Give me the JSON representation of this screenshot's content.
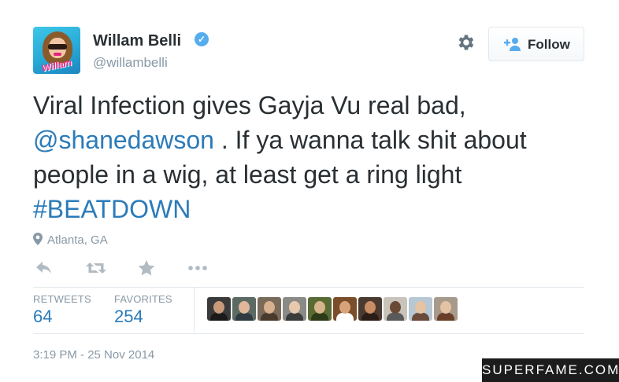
{
  "user": {
    "name": "Willam Belli",
    "handle": "@willambelli",
    "verified_icon": "verified-badge-icon",
    "avatar_logo_text": "Willam"
  },
  "header": {
    "gear_icon": "gear-icon",
    "follow_label": "Follow",
    "follow_icon": "add-person-icon"
  },
  "tweet": {
    "line1": "Viral Infection gives Gayja Vu real bad,",
    "mention": "@shanedawson",
    "line2_rest": " . If ya wanna talk shit about",
    "line3": "people in a wig, at least get a ring light",
    "hashtag": "#BEATDOWN"
  },
  "location": {
    "icon": "location-pin-icon",
    "text": "Atlanta, GA"
  },
  "actions": [
    {
      "icon": "reply-icon"
    },
    {
      "icon": "retweet-icon"
    },
    {
      "icon": "favorite-star-icon"
    },
    {
      "icon": "more-dots-icon"
    }
  ],
  "stats": {
    "retweets_label": "RETWEETS",
    "retweets_value": "64",
    "favorites_label": "FAVORITES",
    "favorites_value": "254"
  },
  "favoriters": [
    {
      "bg": "#3a3a3a",
      "head": "#c79a7a",
      "body": "#1a1a1a"
    },
    {
      "bg": "#5b6b63",
      "head": "#e0b79a",
      "body": "#2e3a40"
    },
    {
      "bg": "#7a6a5a",
      "head": "#d9b08f",
      "body": "#4a3a2e"
    },
    {
      "bg": "#8a8a86",
      "head": "#e8c9ae",
      "body": "#3b3b3b"
    },
    {
      "bg": "#5a6a34",
      "head": "#d7b48c",
      "body": "#2d3a18"
    },
    {
      "bg": "#7a4e2a",
      "head": "#d9a37a",
      "body": "#ffffff"
    },
    {
      "bg": "#4a3a30",
      "head": "#c98c65",
      "body": "#2b1e18"
    },
    {
      "bg": "#c9c4bb",
      "head": "#6b4a35",
      "body": "#5a5a5a"
    },
    {
      "bg": "#b7c7d3",
      "head": "#e6c3a2",
      "body": "#6a4a3a"
    },
    {
      "bg": "#a89a8a",
      "head": "#e4c2a4",
      "body": "#6a3f2a"
    }
  ],
  "timestamp": "3:19 PM - 25 Nov 2014",
  "watermark": "SUPERFAME.COM",
  "colors": {
    "link": "#2b7bb9",
    "muted": "#8899a6",
    "text": "#292f33",
    "verified": "#55acee"
  }
}
